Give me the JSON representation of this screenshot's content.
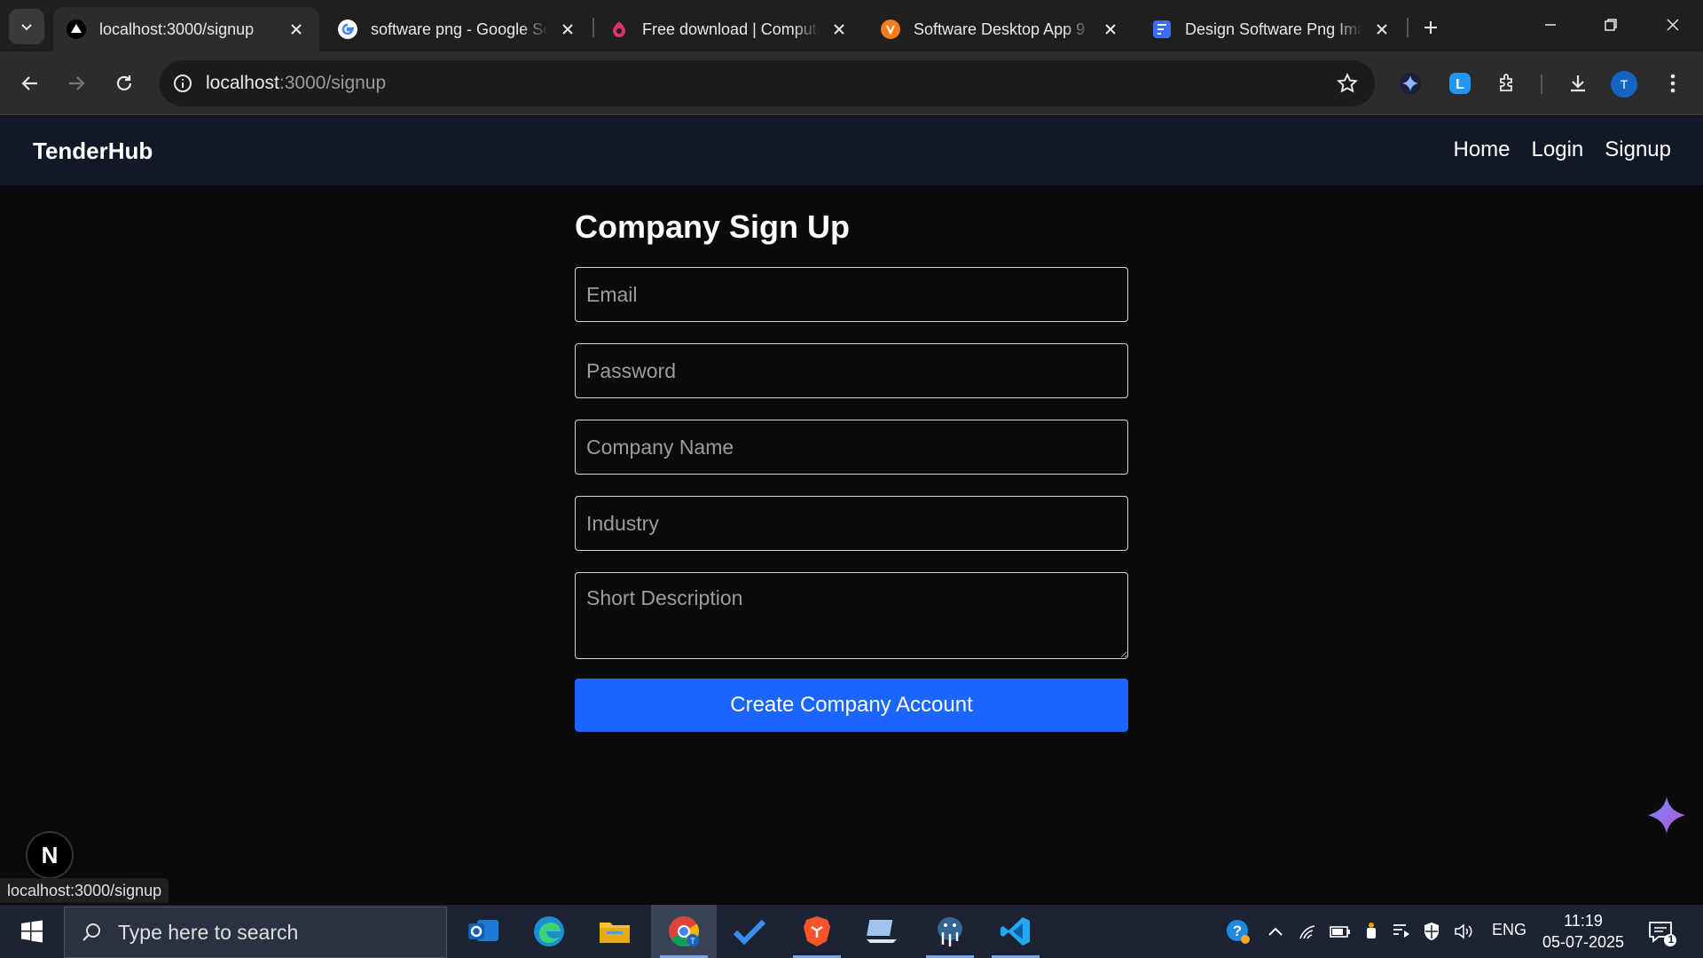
{
  "browser": {
    "tabs": [
      {
        "title": "localhost:3000/signup",
        "icon": "vercel-triangle-icon",
        "active": true
      },
      {
        "title": "software png - Google Search",
        "icon": "google-icon",
        "active": false
      },
      {
        "title": "Free download | Computer",
        "icon": "pinkpng-icon",
        "active": false
      },
      {
        "title": "Software Desktop App 9",
        "icon": "orange-logo-icon",
        "active": false
      },
      {
        "title": "Design Software Png Images",
        "icon": "blue-doc-icon",
        "active": false
      }
    ],
    "url_host": "localhost",
    "url_path": ":3000/signup",
    "profile_initial": "T",
    "status_url": "localhost:3000/signup"
  },
  "site": {
    "brand": "TenderHub",
    "nav": {
      "home": "Home",
      "login": "Login",
      "signup": "Signup"
    }
  },
  "form": {
    "title": "Company Sign Up",
    "email_placeholder": "Email",
    "password_placeholder": "Password",
    "company_placeholder": "Company Name",
    "industry_placeholder": "Industry",
    "description_placeholder": "Short Description",
    "submit_label": "Create Company Account"
  },
  "dev_badge": "N",
  "taskbar": {
    "search_placeholder": "Type here to search",
    "lang": "ENG",
    "time": "11:19",
    "date": "05-07-2025",
    "notifications": "1"
  },
  "colors": {
    "nav_bg": "#111827",
    "page_bg": "#0a0a0a",
    "button": "#1a66ff",
    "taskbar": "#1c2433"
  }
}
